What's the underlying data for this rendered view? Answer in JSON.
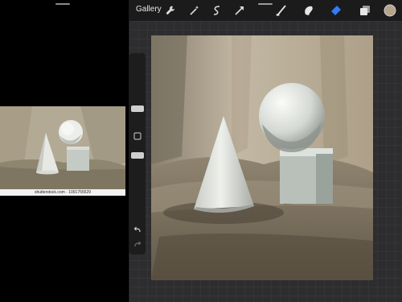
{
  "header": {
    "gallery_label": "Gallery"
  },
  "reference": {
    "caption": "shutterstock.com · 1091755529"
  },
  "toolbar": {
    "tools": [
      "wrench-icon",
      "magic-wand-icon",
      "selection-icon",
      "transform-arrow-icon",
      "brush-icon",
      "smudge-icon",
      "eraser-icon",
      "layers-icon",
      "color-icon"
    ]
  },
  "colors": {
    "accent": "#2f7cf6",
    "current_color": "#b4a58a"
  }
}
